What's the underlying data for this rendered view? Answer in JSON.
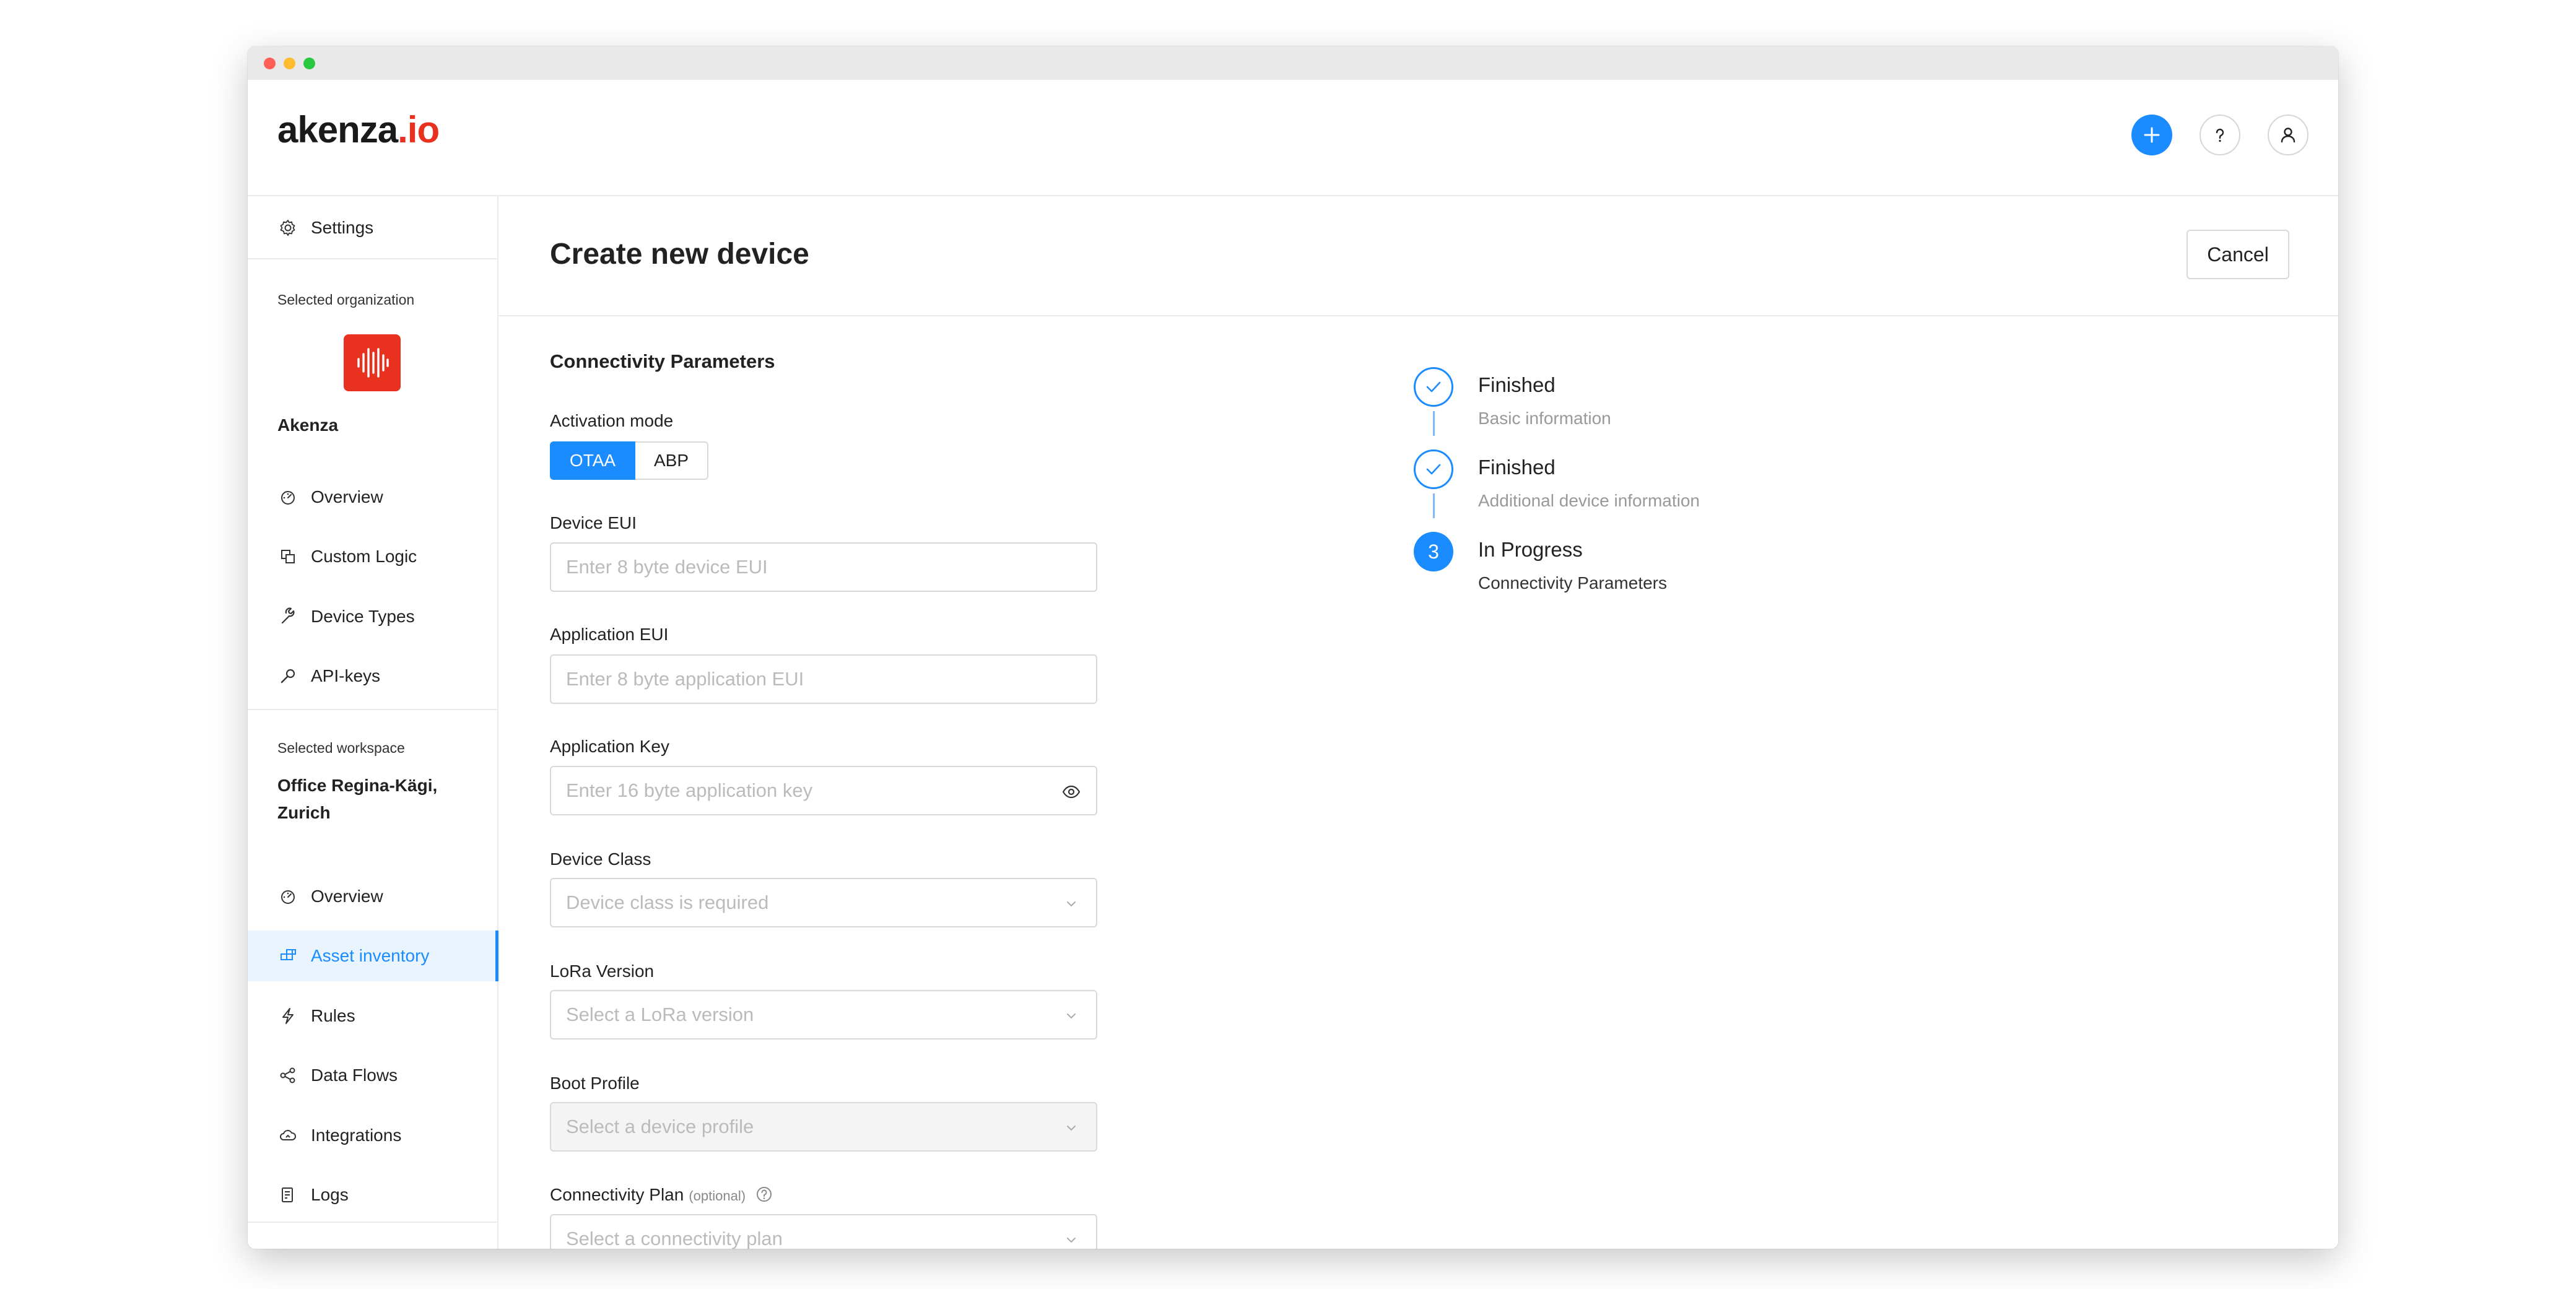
{
  "app": {
    "logo_main": "akenza",
    "logo_accent": ".io"
  },
  "header": {
    "add_icon": "plus-icon",
    "help_icon": "question-icon",
    "user_icon": "user-icon"
  },
  "sidebar": {
    "settings_label": "Settings",
    "org_heading": "Selected organization",
    "org_name": "Akenza",
    "org_items": [
      {
        "label": "Overview",
        "icon": "dashboard-icon"
      },
      {
        "label": "Custom Logic",
        "icon": "copy-icon"
      },
      {
        "label": "Device Types",
        "icon": "wrench-icon"
      },
      {
        "label": "API-keys",
        "icon": "key-icon"
      }
    ],
    "workspace_heading": "Selected workspace",
    "workspace_name_line1": "Office Regina-Kägi,",
    "workspace_name_line2": "Zurich",
    "workspace_items": [
      {
        "label": "Overview",
        "icon": "dashboard-icon"
      },
      {
        "label": "Asset inventory",
        "icon": "inventory-icon",
        "active": true
      },
      {
        "label": "Rules",
        "icon": "bolt-icon"
      },
      {
        "label": "Data Flows",
        "icon": "share-icon"
      },
      {
        "label": "Integrations",
        "icon": "cloud-icon"
      },
      {
        "label": "Logs",
        "icon": "log-icon"
      }
    ]
  },
  "main": {
    "title": "Create new device",
    "cancel_label": "Cancel",
    "section_title": "Connectivity Parameters",
    "activation": {
      "label": "Activation mode",
      "options": [
        "OTAA",
        "ABP"
      ],
      "selected": "OTAA"
    },
    "fields": {
      "device_eui": {
        "label": "Device EUI",
        "placeholder": "Enter 8 byte device EUI"
      },
      "app_eui": {
        "label": "Application EUI",
        "placeholder": "Enter 8 byte application EUI"
      },
      "app_key": {
        "label": "Application Key",
        "placeholder": "Enter 16 byte application key"
      },
      "device_class": {
        "label": "Device Class",
        "placeholder": "Device class is required"
      },
      "lora_version": {
        "label": "LoRa Version",
        "placeholder": "Select a LoRa version"
      },
      "boot_profile": {
        "label": "Boot Profile",
        "placeholder": "Select a device profile"
      },
      "connectivity_plan": {
        "label": "Connectivity Plan",
        "optional": "(optional)",
        "placeholder": "Select a connectivity plan"
      }
    }
  },
  "steps": [
    {
      "status": "Finished",
      "name": "Basic information"
    },
    {
      "status": "Finished",
      "name": "Additional device information"
    },
    {
      "status": "In Progress",
      "name": "Connectivity Parameters",
      "number": "3"
    }
  ],
  "colors": {
    "accent": "#1a8cff",
    "brand": "#e8321f"
  }
}
